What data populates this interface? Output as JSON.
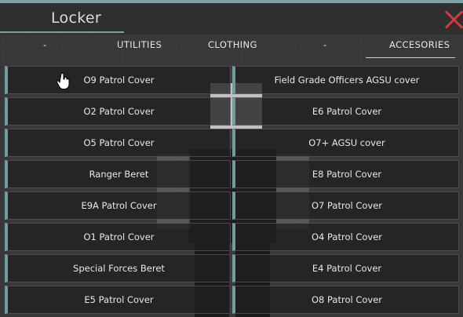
{
  "window": {
    "title": "Locker"
  },
  "tabs": [
    {
      "label": "-"
    },
    {
      "label": "UTILITIES"
    },
    {
      "label": "CLOTHING"
    },
    {
      "label": "-"
    },
    {
      "label": "ACCESORIES"
    }
  ],
  "active_tab": "ACCESORIES",
  "items_left": [
    {
      "label": "O9 Patrol Cover"
    },
    {
      "label": "O2 Patrol Cover"
    },
    {
      "label": "O5 Patrol Cover"
    },
    {
      "label": "Ranger Beret"
    },
    {
      "label": "E9A Patrol Cover"
    },
    {
      "label": "O1 Patrol Cover"
    },
    {
      "label": "Special Forces Beret"
    },
    {
      "label": "E5 Patrol Cover"
    }
  ],
  "items_right": [
    {
      "label": "Field Grade Officers AGSU cover"
    },
    {
      "label": "E6 Patrol Cover"
    },
    {
      "label": "O7+ AGSU cover"
    },
    {
      "label": "E8 Patrol Cover"
    },
    {
      "label": "O7 Patrol Cover"
    },
    {
      "label": "O4 Patrol Cover"
    },
    {
      "label": "E4 Patrol Cover"
    },
    {
      "label": "O8 Patrol Cover"
    }
  ],
  "colors": {
    "accent": "#6f9ea0",
    "close": "#d43a3a"
  },
  "icons": {
    "close": "close-x-icon",
    "cursor": "hand-pointer-icon"
  }
}
